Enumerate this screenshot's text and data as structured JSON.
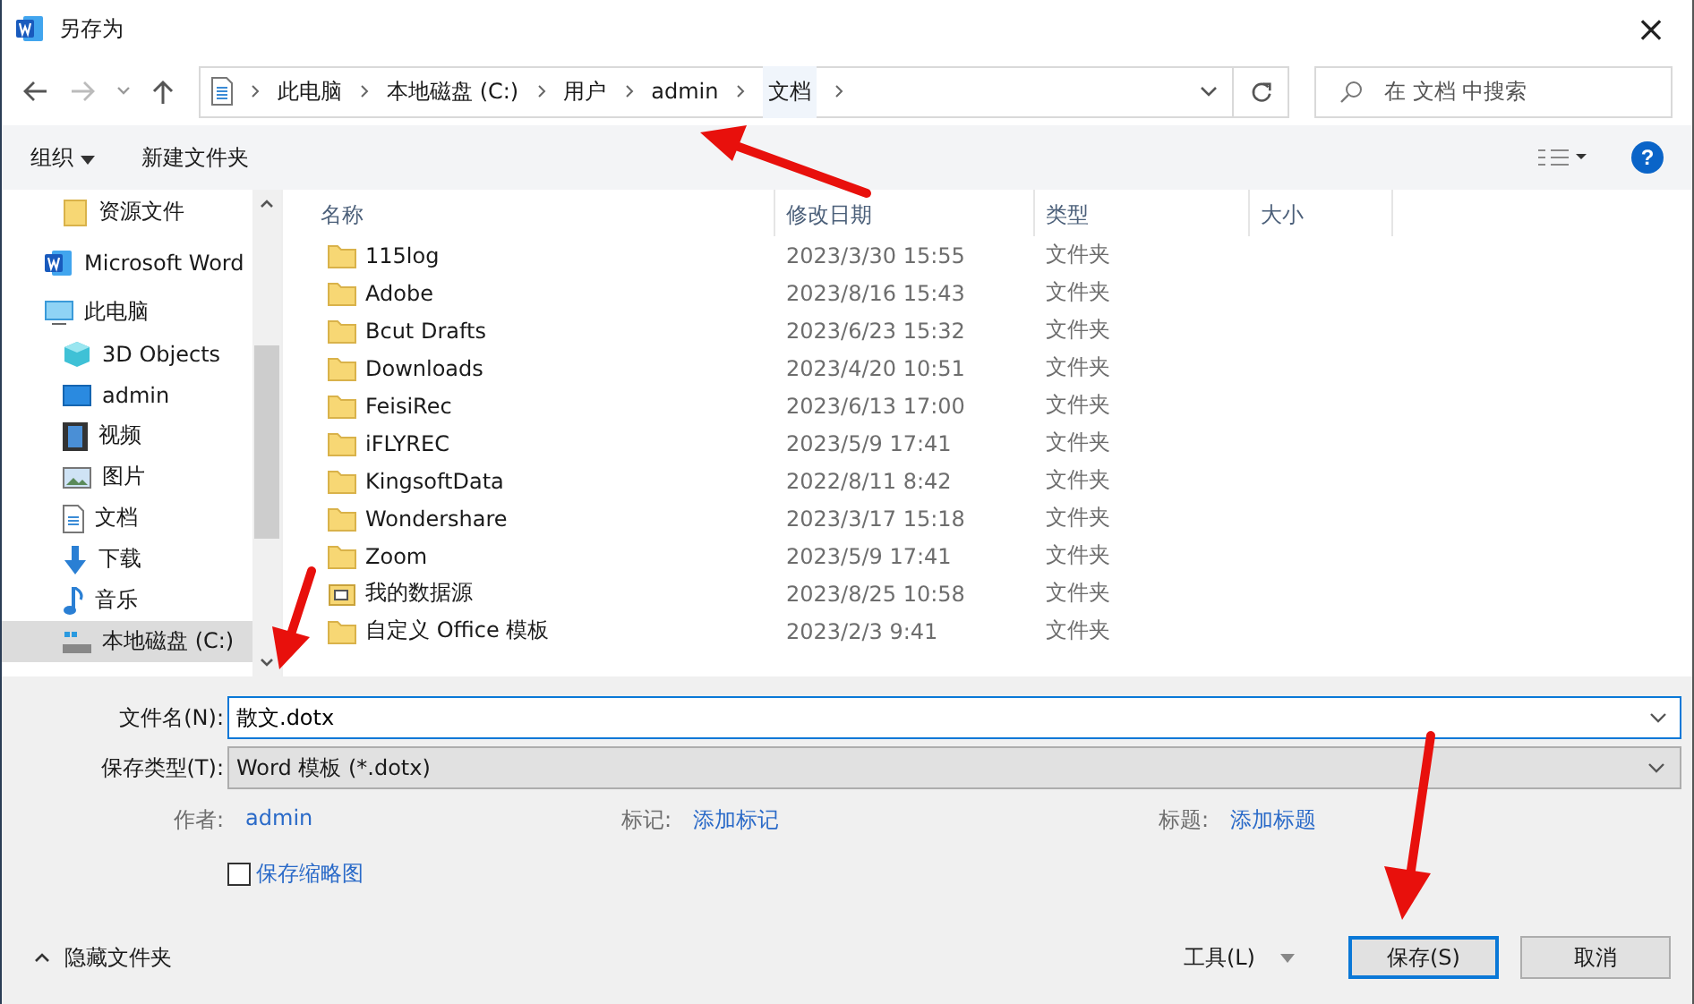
{
  "window": {
    "title": "另存为",
    "close": "×"
  },
  "address": {
    "crumbs": [
      "此电脑",
      "本地磁盘 (C:)",
      "用户",
      "admin",
      "文档"
    ],
    "search_placeholder": "在 文档 中搜索"
  },
  "toolbar": {
    "organize": "组织",
    "new_folder": "新建文件夹",
    "help": "?"
  },
  "sidebar": {
    "items": [
      {
        "label": "资源文件",
        "kind": "folder",
        "selected": false
      },
      {
        "label": "Microsoft Word",
        "kind": "word",
        "selected": false
      },
      {
        "label": "此电脑",
        "kind": "pc",
        "selected": false
      },
      {
        "label": "3D Objects",
        "kind": "cube",
        "selected": false
      },
      {
        "label": "admin",
        "kind": "desktop",
        "selected": false
      },
      {
        "label": "视频",
        "kind": "video",
        "selected": false
      },
      {
        "label": "图片",
        "kind": "picture",
        "selected": false
      },
      {
        "label": "文档",
        "kind": "document",
        "selected": false
      },
      {
        "label": "下载",
        "kind": "download",
        "selected": false
      },
      {
        "label": "音乐",
        "kind": "music",
        "selected": false
      },
      {
        "label": "本地磁盘 (C:)",
        "kind": "drive",
        "selected": true
      }
    ]
  },
  "table": {
    "columns": [
      "名称",
      "修改日期",
      "类型",
      "大小"
    ],
    "rows": [
      {
        "name": "115log",
        "date": "2023/3/30 15:55",
        "type": "文件夹",
        "kind": "folder"
      },
      {
        "name": "Adobe",
        "date": "2023/8/16 15:43",
        "type": "文件夹",
        "kind": "folder"
      },
      {
        "name": "Bcut Drafts",
        "date": "2023/6/23 15:32",
        "type": "文件夹",
        "kind": "folder"
      },
      {
        "name": "Downloads",
        "date": "2023/4/20 10:51",
        "type": "文件夹",
        "kind": "folder"
      },
      {
        "name": "FeisiRec",
        "date": "2023/6/13 17:00",
        "type": "文件夹",
        "kind": "folder"
      },
      {
        "name": "iFLYREC",
        "date": "2023/5/9 17:41",
        "type": "文件夹",
        "kind": "folder"
      },
      {
        "name": "KingsoftData",
        "date": "2022/8/11 8:42",
        "type": "文件夹",
        "kind": "folder"
      },
      {
        "name": "Wondershare",
        "date": "2023/3/17 15:18",
        "type": "文件夹",
        "kind": "folder"
      },
      {
        "name": "Zoom",
        "date": "2023/5/9 17:41",
        "type": "文件夹",
        "kind": "folder"
      },
      {
        "name": "我的数据源",
        "date": "2023/8/25 10:58",
        "type": "文件夹",
        "kind": "datasource"
      },
      {
        "name": "自定义 Office 模板",
        "date": "2023/2/3 9:41",
        "type": "文件夹",
        "kind": "folder"
      }
    ]
  },
  "form": {
    "filename_label": "文件名(N):",
    "filename": "散文.dotx",
    "type_label": "保存类型(T):",
    "type": "Word 模板 (*.dotx)",
    "meta": [
      {
        "label": "作者:",
        "value": "admin"
      },
      {
        "label": "标记:",
        "value": "添加标记"
      },
      {
        "label": "标题:",
        "value": "添加标题"
      }
    ],
    "thumbnail": {
      "label": "保存缩略图",
      "checked": false
    }
  },
  "footer": {
    "hide_folders": "隐藏文件夹",
    "tools": "工具(L)",
    "save": "保存(S)",
    "cancel": "取消"
  }
}
